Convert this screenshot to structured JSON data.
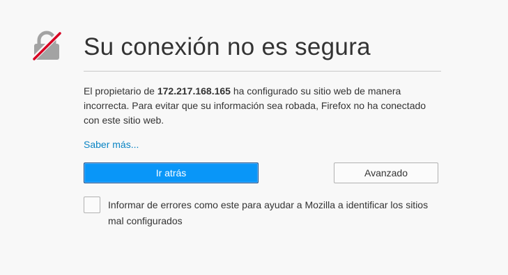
{
  "icon": "broken-lock-icon",
  "colors": {
    "lock": "#a3a3a3",
    "strike": "#d70022",
    "primary": "#0996f8",
    "link": "#0a84c4"
  },
  "error": {
    "title": "Su conexión no es segura",
    "description_prefix": "El propietario de ",
    "host": "172.217.168.165",
    "description_suffix": " ha configurado su sitio web de manera incorrecta. Para evitar que su información sea robada, Firefox no ha conectado con este sitio web.",
    "learn_more": "Saber más...",
    "go_back_label": "Ir atrás",
    "advanced_label": "Avanzado",
    "report_label": "Informar de errores como este para ayudar a Mozilla a identificar los sitios mal configurados",
    "report_checked": false
  }
}
